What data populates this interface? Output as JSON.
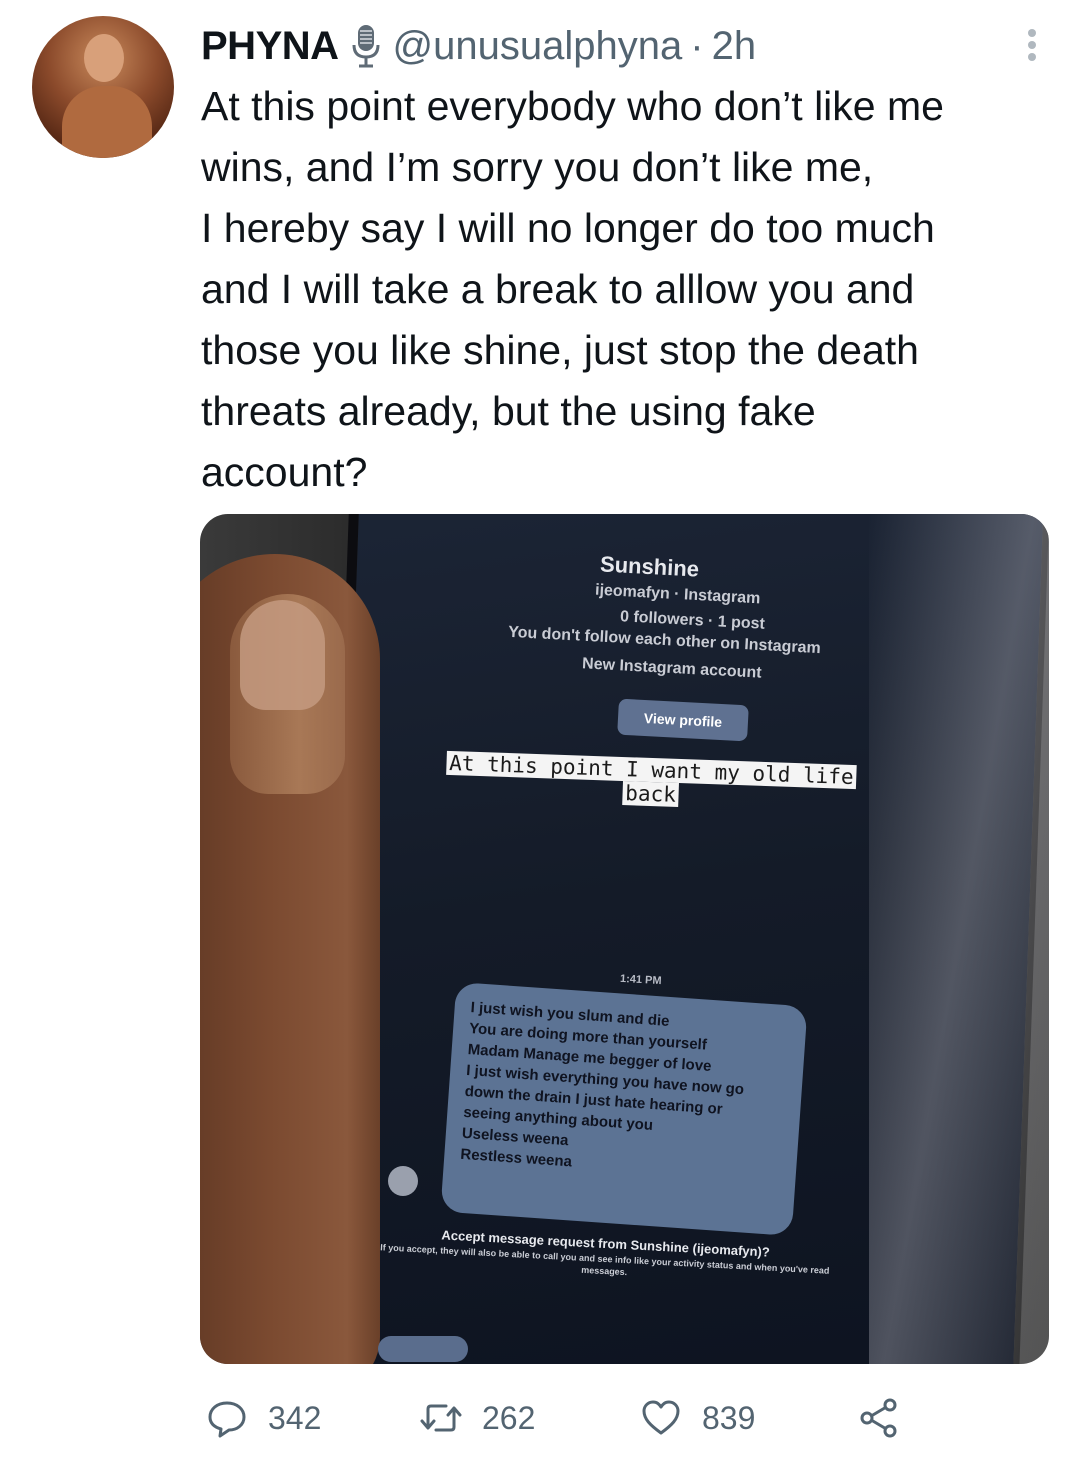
{
  "tweet": {
    "display_name": "PHYNA",
    "handle": "@unusualphyna",
    "separator": "·",
    "time": "2h",
    "text": "At this point everybody who don’t like me\nwins, and I’m sorry you don’t like me,\nI hereby say I will no longer do too much\nand I will take a break to alllow you and\nthose you like shine, just stop the death\nthreats already, but the using fake\naccount?"
  },
  "media": {
    "profile_name": "Sunshine",
    "profile_subtitle": "ijeomafyn · Instagram",
    "profile_stats": "0 followers · 1 post",
    "profile_follow_status": "You don't follow each other on Instagram",
    "profile_new": "New Instagram account",
    "view_profile_label": "View profile",
    "caption": "At this point I want my old life back",
    "message_time": "1:41 PM",
    "message_text": "I just wish you slum and die\nYou are doing more than yourself\nMadam Manage me begger of love\nI just wish everything you have now go\ndown the drain I just hate hearing or\nseeing anything about you\nUseless weena\nRestless weena",
    "accept_title": "Accept message request from Sunshine (ijeomafyn)?",
    "accept_body": "If you accept, they will also be able to call you and see info like your activity status and when you've read messages."
  },
  "actions": {
    "reply_count": "342",
    "retweet_count": "262",
    "like_count": "839"
  },
  "icons": {
    "verified_badge": "microphone-icon",
    "more": "more-vertical-icon",
    "reply": "reply-icon",
    "retweet": "retweet-icon",
    "like": "heart-icon",
    "share": "share-icon"
  },
  "colors": {
    "text_primary": "#0f1419",
    "text_secondary": "#536471"
  }
}
